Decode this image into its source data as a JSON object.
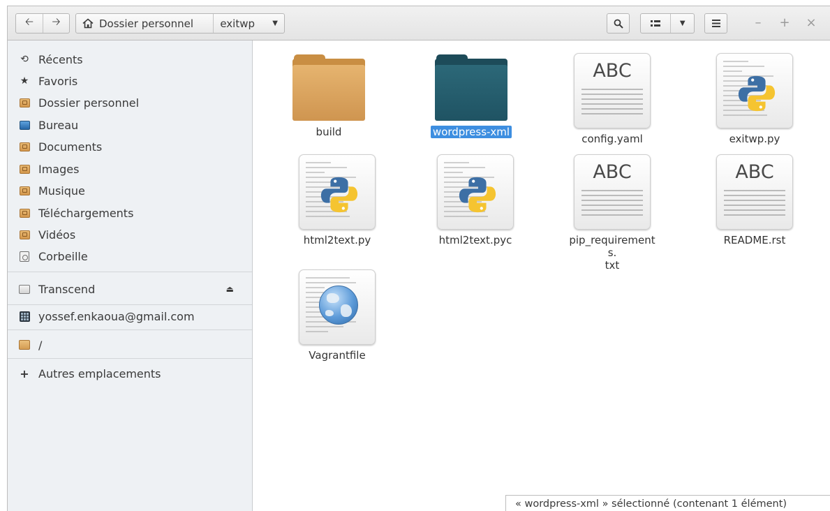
{
  "header": {
    "path": [
      "Dossier personnel",
      "exitwp"
    ]
  },
  "sidebar": {
    "places": [
      {
        "label": "Récents",
        "icon": "recent-icon"
      },
      {
        "label": "Favoris",
        "icon": "star-icon"
      },
      {
        "label": "Dossier personnel",
        "icon": "home-folder-icon"
      },
      {
        "label": "Bureau",
        "icon": "desktop-icon"
      },
      {
        "label": "Documents",
        "icon": "documents-folder-icon"
      },
      {
        "label": "Images",
        "icon": "pictures-folder-icon"
      },
      {
        "label": "Musique",
        "icon": "music-folder-icon"
      },
      {
        "label": "Téléchargements",
        "icon": "downloads-folder-icon"
      },
      {
        "label": "Vidéos",
        "icon": "videos-folder-icon"
      },
      {
        "label": "Corbeille",
        "icon": "trash-icon"
      }
    ],
    "devices": [
      {
        "label": "Transcend",
        "icon": "drive-icon"
      }
    ],
    "network": [
      {
        "label": "yossef.enkaoua@gmail.com",
        "icon": "online-account-icon"
      }
    ],
    "root": {
      "label": "/",
      "icon": "root-folder-icon"
    },
    "other": {
      "label": "Autres emplacements",
      "icon": "plus-icon"
    }
  },
  "files": [
    {
      "name": "build",
      "type": "folder",
      "color": "#d9a25c"
    },
    {
      "name": "wordpress-xml",
      "type": "folder",
      "color": "#2a6171",
      "selected": true
    },
    {
      "name": "config.yaml",
      "type": "text"
    },
    {
      "name": "exitwp.py",
      "type": "python"
    },
    {
      "name": "html2text.py",
      "type": "python"
    },
    {
      "name": "html2text.pyc",
      "type": "python"
    },
    {
      "name": "pip_requirements.\ntxt",
      "type": "text"
    },
    {
      "name": "README.rst",
      "type": "text"
    },
    {
      "name": "Vagrantfile",
      "type": "html"
    }
  ],
  "text_icon_label": "ABC",
  "status": "« wordpress-xml » sélectionné  (contenant 1 élément)",
  "colors": {
    "selection": "#3d8ee0",
    "sidebar_bg": "#eef1f4"
  }
}
